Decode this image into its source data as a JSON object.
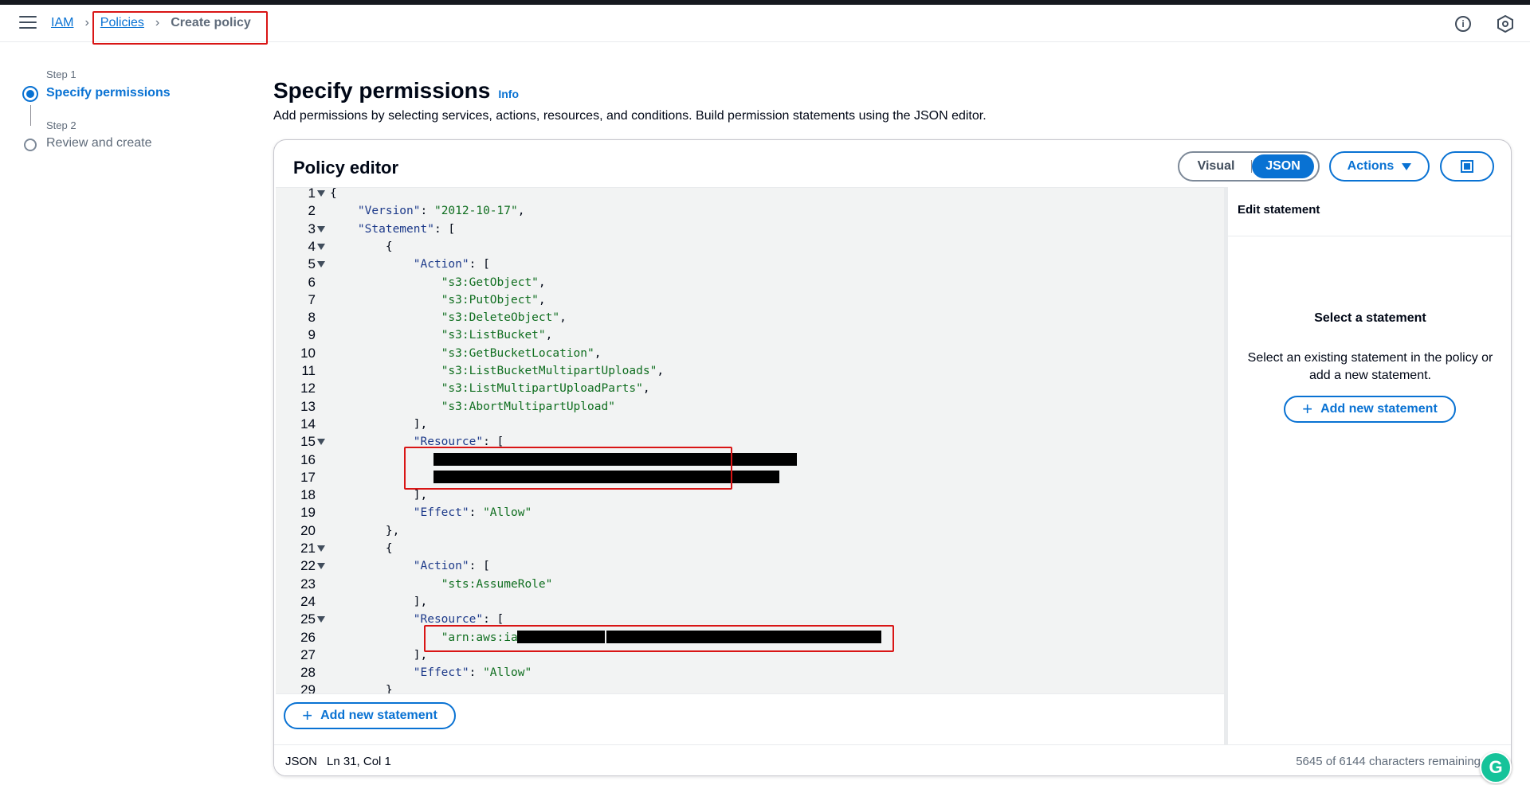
{
  "breadcrumb": {
    "root": "IAM",
    "parent": "Policies",
    "current": "Create policy"
  },
  "steps": [
    {
      "label": "Step 1",
      "title": "Specify permissions"
    },
    {
      "label": "Step 2",
      "title": "Review and create"
    }
  ],
  "page": {
    "title": "Specify permissions",
    "info": "Info",
    "description": "Add permissions by selecting services, actions, resources, and conditions. Build permission statements using the JSON editor."
  },
  "editor": {
    "title": "Policy editor",
    "modes": {
      "visual": "Visual",
      "json": "JSON",
      "selected": "JSON"
    },
    "actions_label": "Actions",
    "add_statement": "Add new statement",
    "status_mode": "JSON",
    "status_position": "Ln 31, Col 1",
    "status_remaining": "5645 of 6144 characters remaining"
  },
  "side_panel": {
    "heading": "Edit statement",
    "title": "Select a statement",
    "description": "Select an existing statement in the policy or add a new statement.",
    "add_statement": "Add new statement"
  },
  "code_lines": [
    {
      "n": "1",
      "text": "{"
    },
    {
      "n": "2",
      "text": "    \"Version\": \"2012-10-17\","
    },
    {
      "n": "3",
      "text": "    \"Statement\": ["
    },
    {
      "n": "4",
      "text": "        {"
    },
    {
      "n": "5",
      "text": "            \"Action\": ["
    },
    {
      "n": "6",
      "text": "                \"s3:GetObject\","
    },
    {
      "n": "7",
      "text": "                \"s3:PutObject\","
    },
    {
      "n": "8",
      "text": "                \"s3:DeleteObject\","
    },
    {
      "n": "9",
      "text": "                \"s3:ListBucket\","
    },
    {
      "n": "10",
      "text": "                \"s3:GetBucketLocation\","
    },
    {
      "n": "11",
      "text": "                \"s3:ListBucketMultipartUploads\","
    },
    {
      "n": "12",
      "text": "                \"s3:ListMultipartUploadParts\","
    },
    {
      "n": "13",
      "text": "                \"s3:AbortMultipartUpload\""
    },
    {
      "n": "14",
      "text": "            ],"
    },
    {
      "n": "15",
      "text": "            \"Resource\": ["
    },
    {
      "n": "16",
      "text": ""
    },
    {
      "n": "17",
      "text": ""
    },
    {
      "n": "18",
      "text": "            ],"
    },
    {
      "n": "19",
      "text": "            \"Effect\": \"Allow\""
    },
    {
      "n": "20",
      "text": "        },"
    },
    {
      "n": "21",
      "text": "        {"
    },
    {
      "n": "22",
      "text": "            \"Action\": ["
    },
    {
      "n": "23",
      "text": "                \"sts:AssumeRole\""
    },
    {
      "n": "24",
      "text": "            ],"
    },
    {
      "n": "25",
      "text": "            \"Resource\": ["
    },
    {
      "n": "26",
      "text": "                \"arn:aws:iam:"
    },
    {
      "n": "27",
      "text": "            ],"
    },
    {
      "n": "28",
      "text": "            \"Effect\": \"Allow\""
    },
    {
      "n": "29",
      "text": "        }"
    }
  ],
  "colors": {
    "accent": "#0972d3",
    "highlight": "#d91515",
    "string": "#0f6e1f"
  }
}
